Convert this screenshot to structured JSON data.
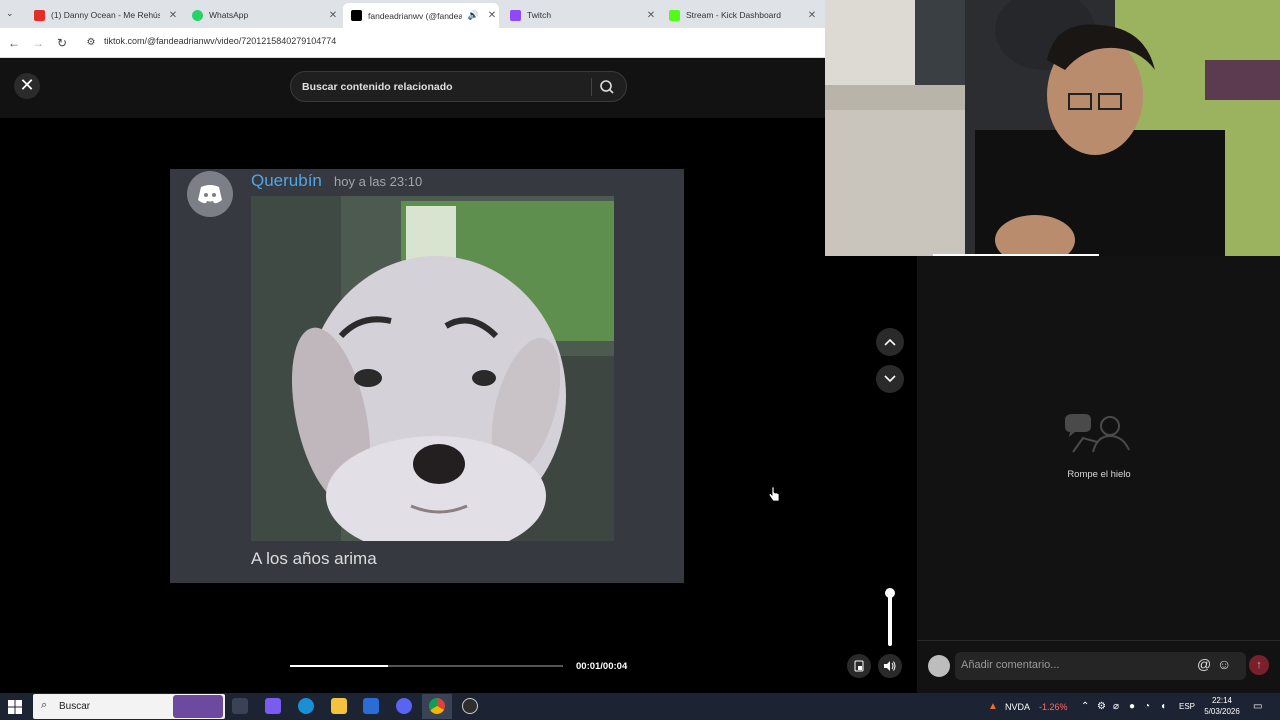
{
  "browser": {
    "tabs": [
      {
        "label": "(1) Danny Ocean - Me Rehúso",
        "favicon_color": "#e52d27",
        "active": false
      },
      {
        "label": "WhatsApp",
        "favicon_color": "#25d366",
        "active": false
      },
      {
        "label": "fandeadrianwv (@fandead",
        "favicon_color": "#000000",
        "active": true
      },
      {
        "label": "Twitch",
        "favicon_color": "#9146ff",
        "active": false
      },
      {
        "label": "Stream - Kick Dashboard",
        "favicon_color": "#53fc18",
        "active": false
      }
    ],
    "url": "tiktok.com/@fandeadrianwv/video/7201215840279104774"
  },
  "tiktok": {
    "search_placeholder": "Buscar contenido relacionado",
    "post": {
      "username": "Querubín",
      "timestamp": "hoy a las 23:10",
      "caption": "A los años arima"
    },
    "player": {
      "time": "00:01/00:04",
      "progress": 0.36
    },
    "comments": {
      "empty_text": "Rompe el hielo",
      "input_placeholder": "Añadir comentario..."
    }
  },
  "taskbar": {
    "search_label": "Buscar",
    "tray": {
      "stock_name": "NVDA",
      "stock_change": "-1.26%",
      "language": "ESP",
      "time": "22:14",
      "date": "5/03/2026"
    }
  },
  "colors": {
    "discord_name": "#4fa6e6",
    "send_button": "#7a1f2c",
    "stock_down": "#ff6b6b"
  }
}
